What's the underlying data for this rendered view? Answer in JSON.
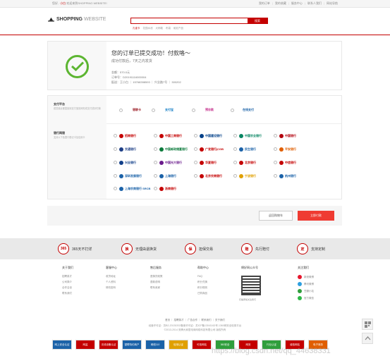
{
  "topbar": {
    "greeting": "您好,",
    "username": "小白",
    "welcome": "欢迎来到SHOPPING WEBSITE!",
    "links": [
      "我的订单",
      "我的收藏",
      "服务中心",
      "联系人我们",
      "网站导航"
    ]
  },
  "header": {
    "logo_bold": "SHOPPING",
    "logo_light": "WEBSITE",
    "search_placeholder": "",
    "search_button": "搜索",
    "hot_words": [
      "孔雀卡",
      "花园水池",
      "大码鞋",
      "布袋",
      "维尼产品"
    ]
  },
  "success": {
    "title": "您的订单已提交成功！付款咯～",
    "subtitle": "成功付款后，7天之内发货",
    "amount_label": "金额：",
    "amount": "570.0元",
    "order_label": "订单号：",
    "order_no": "D20191116000004",
    "delivery_label": "配送：",
    "delivery": "王小白 ｜ 15768398593 ｜ 兴业路7号 ｜ 300202"
  },
  "payment": {
    "platform_title": "支付平台",
    "platform_desc": "若您最近都直接到支付宝官网完成支付或到付款",
    "bank_title": "银行网银",
    "bank_desc": "支持以下各银行借记卡及信用卡",
    "platforms": [
      {
        "name": "银联卡",
        "color": "#9b1b24"
      },
      {
        "name": "支付宝",
        "color": "#0b79c4"
      },
      {
        "name": "预存款",
        "color": "#c6338e"
      },
      {
        "name": "在线支付",
        "color": "#1b62a8"
      }
    ],
    "banks": [
      {
        "name": "招商银行",
        "color": "#c40000"
      },
      {
        "name": "中国工商银行",
        "color": "#c40000"
      },
      {
        "name": "中国建设银行",
        "color": "#003f88"
      },
      {
        "name": "中国农业银行",
        "color": "#078562"
      },
      {
        "name": "中国银行",
        "color": "#b2000d"
      },
      {
        "name": "交通银行",
        "color": "#1e3f86"
      },
      {
        "name": "中国邮政储蓄银行",
        "color": "#0b7a3b"
      },
      {
        "name": "广发银行|CGB",
        "color": "#c40000"
      },
      {
        "name": "民生银行",
        "color": "#1b62a8"
      },
      {
        "name": "平安银行",
        "color": "#e05e00"
      },
      {
        "name": "兴业银行",
        "color": "#113f89"
      },
      {
        "name": "中国光大银行",
        "color": "#6a1b8c"
      },
      {
        "name": "华夏银行",
        "color": "#c40000"
      },
      {
        "name": "北京银行",
        "color": "#c40000"
      },
      {
        "name": "中信银行",
        "color": "#c40000"
      },
      {
        "name": "深圳发展银行",
        "color": "#1b62a8"
      },
      {
        "name": "上海银行",
        "color": "#1b62a8"
      },
      {
        "name": "北京农商银行",
        "color": "#c40000"
      },
      {
        "name": "宁波银行",
        "color": "#e0a000"
      },
      {
        "name": "杭州银行",
        "color": "#1b62a8"
      },
      {
        "name": "上海农商银行 SRCB",
        "color": "#1b62a8"
      },
      {
        "name": "浙商银行",
        "color": "#c40000"
      }
    ]
  },
  "actions": {
    "back": "返回购物车",
    "pay": "立即付款"
  },
  "services": [
    {
      "icon": "365",
      "label": "365天不打烊"
    },
    {
      "icon": "换",
      "label": "无理由退换货"
    },
    {
      "icon": "保",
      "label": "担保交易"
    },
    {
      "icon": "赔",
      "label": "先行赔付"
    },
    {
      "icon": "定",
      "label": "支持定制"
    }
  ],
  "footer": {
    "columns": [
      {
        "title": "关于我们",
        "items": [
          "招聘英才",
          "公司简介",
          "合作洽谈",
          "联系我们"
        ]
      },
      {
        "title": "客服中心",
        "items": [
          "收货地址",
          "个人资料",
          "修改密码"
        ]
      },
      {
        "title": "售后服务",
        "items": [
          "退换货政策",
          "退款说明",
          "联系卖家"
        ]
      },
      {
        "title": "帮助中心",
        "items": [
          "FAQ",
          "积分兑换",
          "积分规则",
          "已购商品"
        ]
      }
    ],
    "qr_title": "绵好网公众号",
    "qr_caption": "扫描添加关注我们",
    "follow_title": "关注我们",
    "follow": [
      {
        "label": "新浪微博",
        "color": "#e6162d"
      },
      {
        "label": "腾讯微博",
        "color": "#2d9fe0"
      },
      {
        "label": "豆瓣小站",
        "color": "#2f9e3c"
      },
      {
        "label": "官方微信",
        "color": "#2db847"
      }
    ],
    "links_line": "首页 ｜ 招聘英才 ｜ 广告合作 ｜ 联系我们 ｜ 关于我们",
    "copy1": "经营许可证：苏B2-20130202备案许可证：苏ICP备13041162号-1360网安全检测平台",
    "copy2": "©2013-2014 安腾大家居电商网络科技有限公司 版权所有"
  },
  "badges": [
    {
      "label": "网上安全认证",
      "color": "#1b62a8"
    },
    {
      "label": "网监",
      "color": "#c40000"
    },
    {
      "label": "无线设备认证",
      "color": "#c40000"
    },
    {
      "label": "银联特约商户",
      "color": "#1b62a8"
    },
    {
      "label": "网络110",
      "color": "#1b62a8"
    },
    {
      "label": "信用认证",
      "color": "#e0a000"
    },
    {
      "label": "可信网站",
      "color": "#c40000"
    },
    {
      "label": "360安全",
      "color": "#2f9e3c"
    },
    {
      "label": "网安",
      "color": "#c40000"
    },
    {
      "label": "行业认证",
      "color": "#2f9e3c"
    },
    {
      "label": "诚信网站",
      "color": "#c40000"
    },
    {
      "label": "电子商务",
      "color": "#e05e00"
    }
  ],
  "watermark": "https://blog.csdn.net/qq_44638331"
}
